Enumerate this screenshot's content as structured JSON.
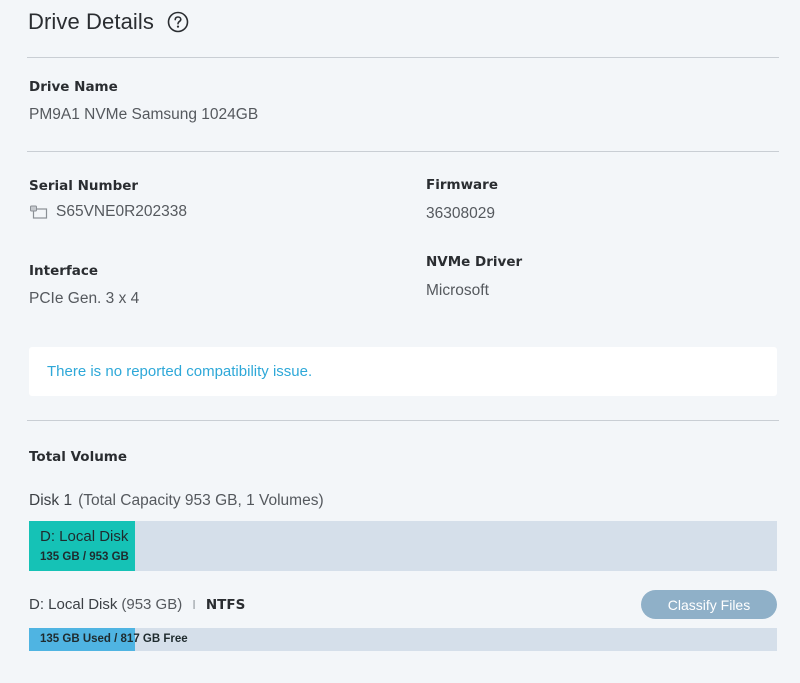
{
  "header": {
    "title": "Drive Details"
  },
  "drive": {
    "name_label": "Drive Name",
    "name_value": "PM9A1 NVMe Samsung 1024GB",
    "serial_label": "Serial Number",
    "serial_value": "S65VNE0R202338",
    "firmware_label": "Firmware",
    "firmware_value": "36308029",
    "interface_label": "Interface",
    "interface_value": "PCIe Gen. 3 x 4",
    "driver_label": "NVMe Driver",
    "driver_value": "Microsoft"
  },
  "notice": {
    "text": "There is no reported compatibility issue."
  },
  "volume": {
    "section_label": "Total Volume",
    "disk_name": "Disk 1",
    "disk_detail": "(Total Capacity 953 GB, 1 Volumes)",
    "disk_bar_title": "D: Local Disk",
    "disk_bar_sub": "135 GB / 953 GB",
    "disk_used_fraction": 0.1417,
    "vol_name": "D: Local Disk",
    "vol_size": "(953 GB)",
    "separator": "I",
    "filesystem": "NTFS",
    "classify_label": "Classify Files",
    "vol_bar_text": "135 GB Used / 817 GB Free",
    "vol_used_fraction": 0.1417
  },
  "colors": {
    "disk_fill": "#15c2b6",
    "vol_fill": "#4fb4e2",
    "bar_track": "#d5dfea",
    "notice_text": "#2ea8d8",
    "button_bg": "#8fb0c8"
  },
  "icons": {
    "help": "question-circle-icon",
    "serial": "copy-card-icon"
  }
}
